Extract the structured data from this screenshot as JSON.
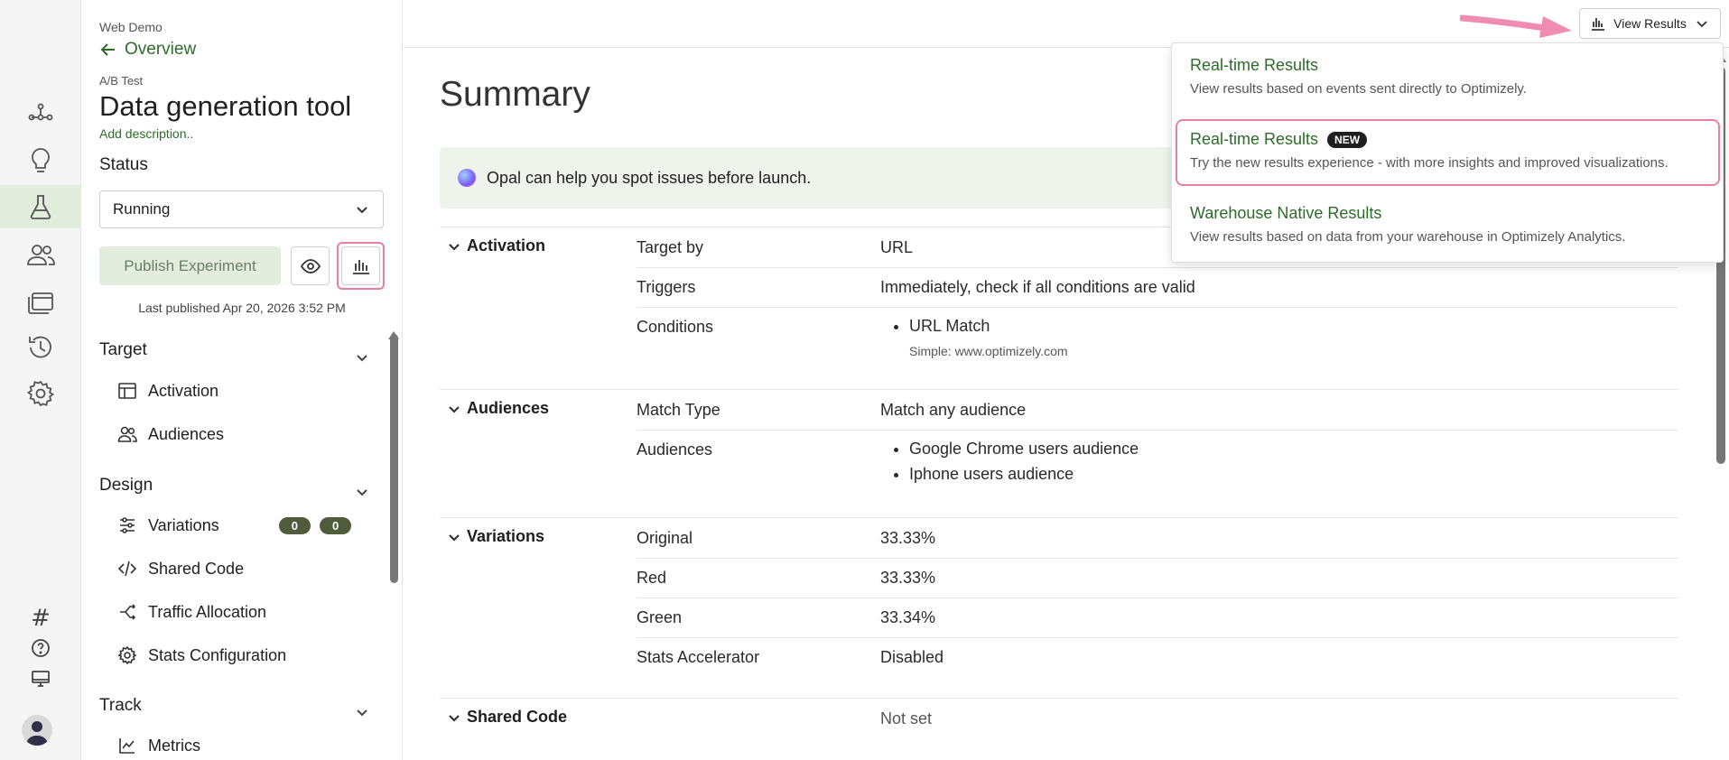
{
  "rail": {
    "items": [
      "flow-icon",
      "lightbulb-icon",
      "flask-icon",
      "users-icon",
      "layers-icon",
      "history-icon",
      "gear-icon"
    ],
    "bottom": [
      "#",
      "help-icon",
      "monitor-icon"
    ]
  },
  "sidebar": {
    "breadcrumb": "Web Demo",
    "back_label": "Overview",
    "type_label": "A/B Test",
    "title": "Data generation tool",
    "add_description": "Add description..",
    "status_label": "Status",
    "status_value": "Running",
    "publish_label": "Publish Experiment",
    "last_published": "Last published Apr 20, 2026 3:52 PM",
    "sections": {
      "target": "Target",
      "design": "Design",
      "track": "Track"
    },
    "items": {
      "activation": "Activation",
      "audiences": "Audiences",
      "variations": "Variations",
      "variations_badge_1": "0",
      "variations_badge_2": "0",
      "shared_code": "Shared Code",
      "traffic_allocation": "Traffic Allocation",
      "stats_configuration": "Stats Configuration",
      "metrics": "Metrics"
    }
  },
  "main": {
    "title": "Summary",
    "opal_banner": "Opal can help you spot issues before launch.",
    "view_results": "View Results",
    "activation": {
      "heading": "Activation",
      "target_by_k": "Target by",
      "target_by_v": "URL",
      "triggers_k": "Triggers",
      "triggers_v": "Immediately, check if all conditions are valid",
      "conditions_k": "Conditions",
      "condition_1": "URL Match",
      "condition_1_sub": "Simple: www.optimizely.com"
    },
    "audiences": {
      "heading": "Audiences",
      "match_type_k": "Match Type",
      "match_type_v": "Match any audience",
      "audiences_k": "Audiences",
      "audience_1": "Google Chrome users audience",
      "audience_2": "Iphone users audience"
    },
    "variations": {
      "heading": "Variations",
      "original_k": "Original",
      "original_v": "33.33%",
      "red_k": "Red",
      "red_v": "33.33%",
      "green_k": "Green",
      "green_v": "33.34%",
      "stats_k": "Stats Accelerator",
      "stats_v": "Disabled"
    },
    "shared_code": {
      "heading": "Shared Code",
      "value": "Not set"
    }
  },
  "dropdown": {
    "items": [
      {
        "title": "Real-time Results",
        "desc": "View results based on events sent directly to Optimizely."
      },
      {
        "title": "Real-time Results",
        "badge": "NEW",
        "desc": "Try the new results experience - with more insights and improved visualizations."
      },
      {
        "title": "Warehouse Native Results",
        "desc": "View results based on data from your warehouse in Optimizely Analytics."
      }
    ]
  },
  "colors": {
    "accent": "#2e6b2a",
    "highlight": "#e77fa5",
    "active_bg": "#e3eddd"
  }
}
